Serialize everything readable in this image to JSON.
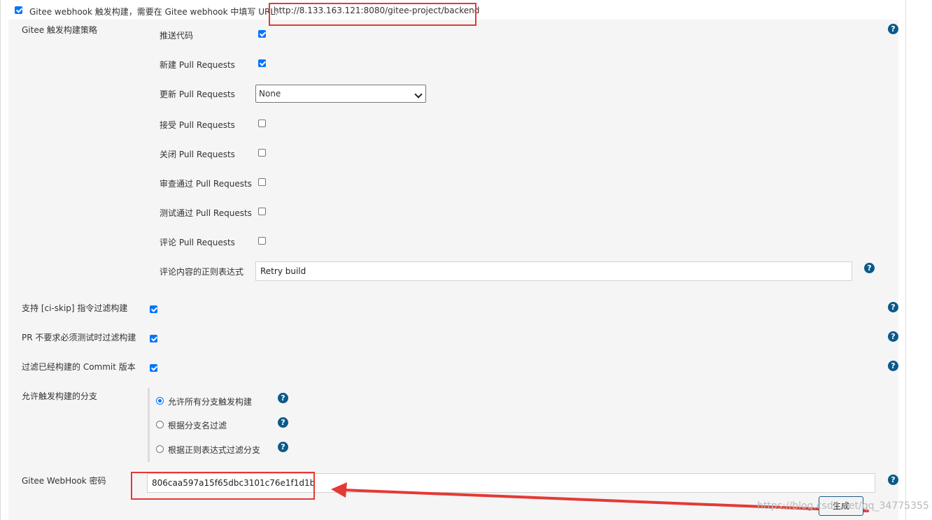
{
  "header": {
    "webhook_label": "Gitee webhook 触发构建，需要在 Gitee webhook 中填写 URL:",
    "webhook_url": "http://8.133.163.121:8080/gitee-project/backend"
  },
  "strategy": {
    "title": "Gitee 触发构建策略",
    "items": [
      {
        "label": "推送代码",
        "checked": true
      },
      {
        "label": "新建 Pull Requests",
        "checked": true
      },
      {
        "label": "更新 Pull Requests"
      },
      {
        "label": "接受 Pull Requests",
        "checked": false
      },
      {
        "label": "关闭 Pull Requests",
        "checked": false
      },
      {
        "label": "审查通过 Pull Requests",
        "checked": false
      },
      {
        "label": "测试通过 Pull Requests",
        "checked": false
      },
      {
        "label": "评论 Pull Requests",
        "checked": false
      }
    ],
    "update_pr_select": "None",
    "comment_regex_label": "评论内容的正则表达式",
    "comment_regex_value": "Retry build"
  },
  "options": {
    "ci_skip": "支持 [ci-skip] 指令过滤构建",
    "pr_no_test": "PR 不要求必须测试时过滤构建",
    "filter_commit": "过滤已经构建的 Commit 版本"
  },
  "branches": {
    "title": "允许触发构建的分支",
    "options": [
      "允许所有分支触发构建",
      "根据分支名过滤",
      "根据正则表达式过滤分支"
    ],
    "selected_index": 0
  },
  "secret": {
    "label": "Gitee WebHook 密码",
    "value": "806caa597a15f65dbc3101c76e1f1d1b",
    "generate_button": "生成"
  },
  "help_glyph": "?",
  "watermark": "https://blog.csdn.net/qq_34775355",
  "colors": {
    "accent": "#0075ff",
    "help": "#0a5a8a",
    "annotation_red": "#e53935",
    "panel_bg": "#f5f5f5"
  }
}
